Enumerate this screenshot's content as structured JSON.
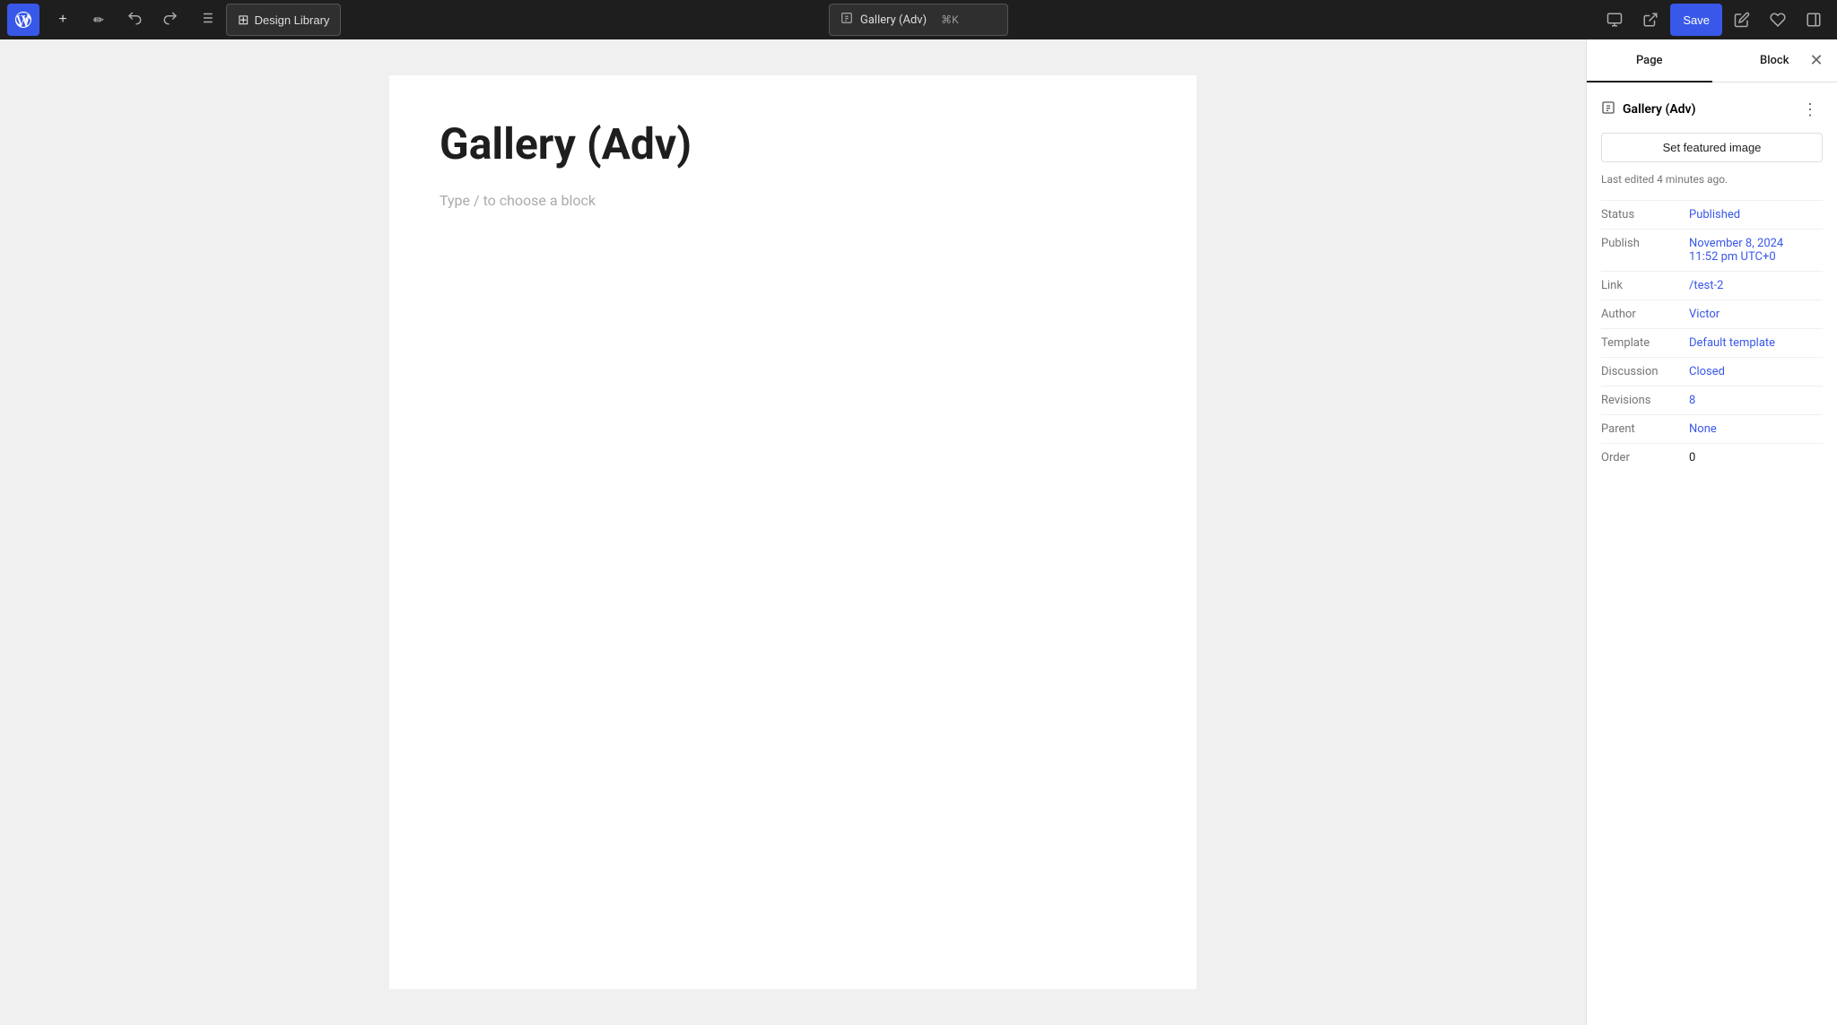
{
  "topbar": {
    "wp_logo_label": "WordPress",
    "add_button_label": "+",
    "tools_button_label": "✏",
    "undo_button_label": "↺",
    "redo_button_label": "↻",
    "list_view_label": "☰",
    "design_library_label": "Design Library",
    "design_library_icon": "⊞",
    "post_title": "Gallery (Adv)",
    "shortcut": "⌘K",
    "save_label": "Save",
    "view_button": "👁",
    "external_button": "⎋",
    "patterns_button": "✦",
    "more_button": "⋮"
  },
  "editor": {
    "page_title": "Gallery (Adv)",
    "block_placeholder": "Type / to choose a block"
  },
  "right_panel": {
    "tab_page": "Page",
    "tab_block": "Block",
    "close_label": "✕",
    "page_icon": "▤",
    "page_name": "Gallery (Adv)",
    "more_label": "⋮",
    "set_featured_image": "Set featured image",
    "last_edited": "Last edited 4 minutes ago.",
    "meta": [
      {
        "label": "Status",
        "value": "Published",
        "is_link": true
      },
      {
        "label": "Publish",
        "value": "November 8, 2024\n11:52 pm UTC+0",
        "is_link": true
      },
      {
        "label": "Link",
        "value": "/test-2",
        "is_link": true
      },
      {
        "label": "Author",
        "value": "Victor",
        "is_link": true
      },
      {
        "label": "Template",
        "value": "Default template",
        "is_link": true
      },
      {
        "label": "Discussion",
        "value": "Closed",
        "is_link": true
      },
      {
        "label": "Revisions",
        "value": "8",
        "is_link": true
      },
      {
        "label": "Parent",
        "value": "None",
        "is_link": true
      },
      {
        "label": "Order",
        "value": "0",
        "is_link": false
      }
    ]
  },
  "colors": {
    "accent": "#3858e9",
    "link": "#3858e9",
    "topbar_bg": "#1e1e1e"
  }
}
